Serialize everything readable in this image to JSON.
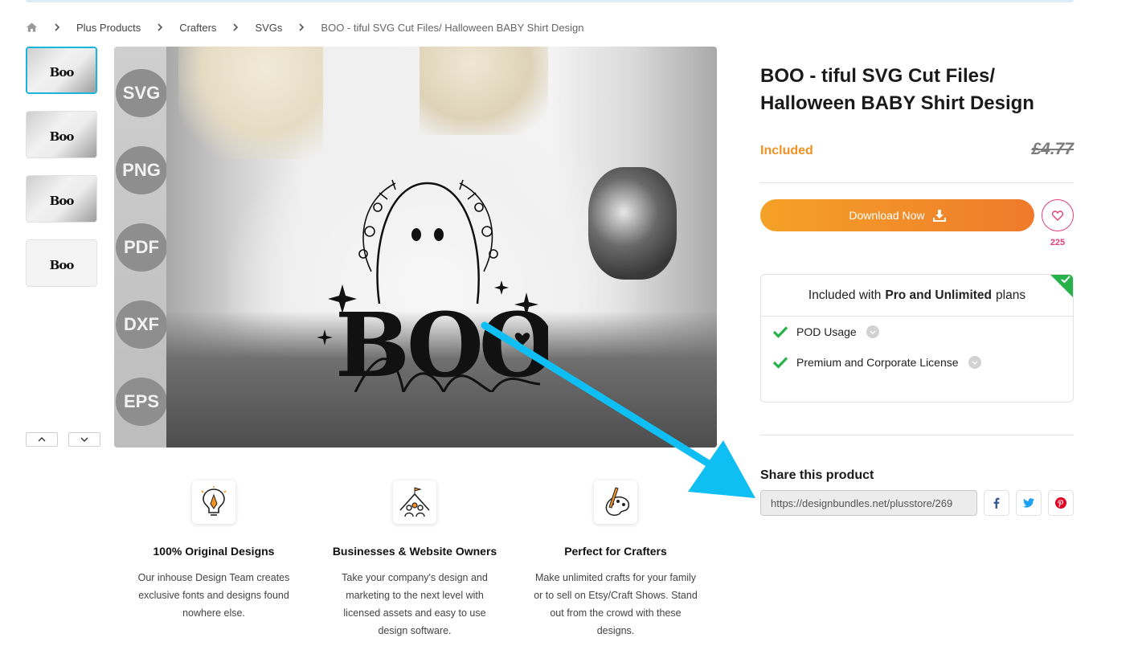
{
  "breadcrumb": {
    "items": [
      "Plus Products",
      "Crafters",
      "SVGs"
    ],
    "current": "BOO - tiful SVG Cut Files/ Halloween BABY Shirt Design"
  },
  "gallery": {
    "formats": [
      "SVG",
      "PNG",
      "PDF",
      "DXF",
      "EPS"
    ],
    "thumb_text": "Boo"
  },
  "product": {
    "title": "BOO - tiful SVG Cut Files/ Halloween BABY Shirt Design",
    "price_status": "Included",
    "old_price": "£4.77",
    "download_label": "Download Now",
    "favorites_count": "225"
  },
  "plans": {
    "prefix": "Included with",
    "bold": "Pro and Unlimited",
    "suffix": "plans",
    "items": [
      "POD Usage",
      "Premium and Corporate License"
    ]
  },
  "share": {
    "title": "Share this product",
    "url": "https://designbundles.net/plusstore/269"
  },
  "features": [
    {
      "title": "100% Original Designs",
      "text": "Our inhouse Design Team creates exclusive fonts and designs found nowhere else."
    },
    {
      "title": "Businesses & Website Owners",
      "text": "Take your company's design and marketing to the next level with licensed assets and easy to use design software."
    },
    {
      "title": "Perfect for Crafters",
      "text": "Make unlimited crafts for your family or to sell on Etsy/Craft Shows. Stand out from the crowd with these designs."
    }
  ],
  "colors": {
    "accent": "#f29223",
    "favorite": "#e0407e",
    "check": "#27b14a",
    "annotation_arrow": "#0fbef2"
  },
  "icons": {
    "home": "home-icon",
    "download": "download-icon",
    "favorite": "heart-icon",
    "facebook": "facebook-icon",
    "twitter": "twitter-icon",
    "pinterest": "pinterest-icon"
  }
}
